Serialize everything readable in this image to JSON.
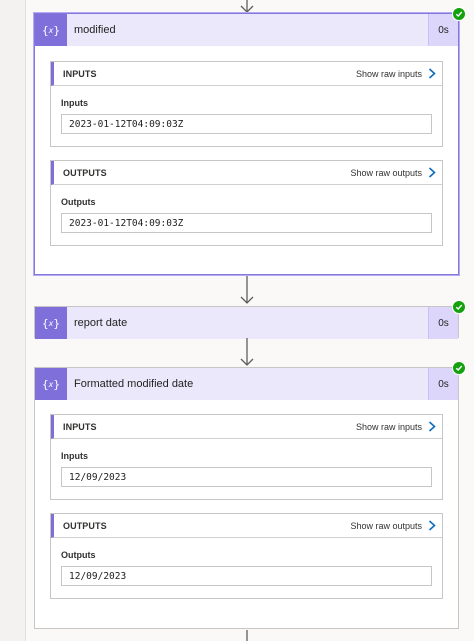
{
  "colors": {
    "accent": "#7e6fda",
    "header_bg": "#ebe8fc",
    "success": "#13a10e",
    "link_blue": "#0f6cbd"
  },
  "icons": {
    "action": "variable-braces-icon",
    "chevron": "chevron-right-icon",
    "status": "success-check-icon",
    "connector": "arrow-down-icon"
  },
  "cards": [
    {
      "title": "modified",
      "duration": "0s",
      "inputs": {
        "header": "INPUTS",
        "show_raw": "Show raw inputs",
        "field_label": "Inputs",
        "field_value": "2023-01-12T04:09:03Z"
      },
      "outputs": {
        "header": "OUTPUTS",
        "show_raw": "Show raw outputs",
        "field_label": "Outputs",
        "field_value": "2023-01-12T04:09:03Z"
      }
    },
    {
      "title": "report date",
      "duration": "0s"
    },
    {
      "title": "Formatted modified date",
      "duration": "0s",
      "inputs": {
        "header": "INPUTS",
        "show_raw": "Show raw inputs",
        "field_label": "Inputs",
        "field_value": "12/09/2023"
      },
      "outputs": {
        "header": "OUTPUTS",
        "show_raw": "Show raw outputs",
        "field_label": "Outputs",
        "field_value": "12/09/2023"
      }
    }
  ]
}
